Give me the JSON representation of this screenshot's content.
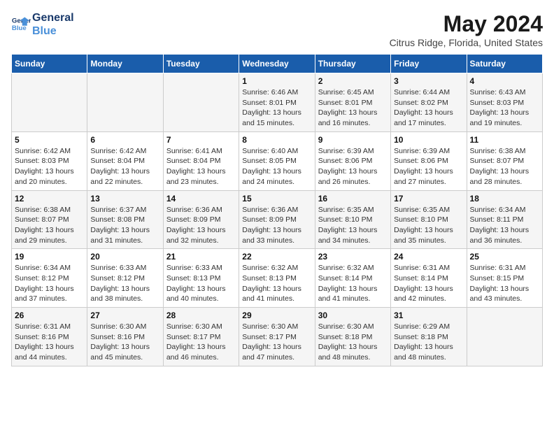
{
  "header": {
    "logo_line1": "General",
    "logo_line2": "Blue",
    "title": "May 2024",
    "subtitle": "Citrus Ridge, Florida, United States"
  },
  "weekdays": [
    "Sunday",
    "Monday",
    "Tuesday",
    "Wednesday",
    "Thursday",
    "Friday",
    "Saturday"
  ],
  "weeks": [
    [
      {
        "day": "",
        "info": ""
      },
      {
        "day": "",
        "info": ""
      },
      {
        "day": "",
        "info": ""
      },
      {
        "day": "1",
        "info": "Sunrise: 6:46 AM\nSunset: 8:01 PM\nDaylight: 13 hours\nand 15 minutes."
      },
      {
        "day": "2",
        "info": "Sunrise: 6:45 AM\nSunset: 8:01 PM\nDaylight: 13 hours\nand 16 minutes."
      },
      {
        "day": "3",
        "info": "Sunrise: 6:44 AM\nSunset: 8:02 PM\nDaylight: 13 hours\nand 17 minutes."
      },
      {
        "day": "4",
        "info": "Sunrise: 6:43 AM\nSunset: 8:03 PM\nDaylight: 13 hours\nand 19 minutes."
      }
    ],
    [
      {
        "day": "5",
        "info": "Sunrise: 6:42 AM\nSunset: 8:03 PM\nDaylight: 13 hours\nand 20 minutes."
      },
      {
        "day": "6",
        "info": "Sunrise: 6:42 AM\nSunset: 8:04 PM\nDaylight: 13 hours\nand 22 minutes."
      },
      {
        "day": "7",
        "info": "Sunrise: 6:41 AM\nSunset: 8:04 PM\nDaylight: 13 hours\nand 23 minutes."
      },
      {
        "day": "8",
        "info": "Sunrise: 6:40 AM\nSunset: 8:05 PM\nDaylight: 13 hours\nand 24 minutes."
      },
      {
        "day": "9",
        "info": "Sunrise: 6:39 AM\nSunset: 8:06 PM\nDaylight: 13 hours\nand 26 minutes."
      },
      {
        "day": "10",
        "info": "Sunrise: 6:39 AM\nSunset: 8:06 PM\nDaylight: 13 hours\nand 27 minutes."
      },
      {
        "day": "11",
        "info": "Sunrise: 6:38 AM\nSunset: 8:07 PM\nDaylight: 13 hours\nand 28 minutes."
      }
    ],
    [
      {
        "day": "12",
        "info": "Sunrise: 6:38 AM\nSunset: 8:07 PM\nDaylight: 13 hours\nand 29 minutes."
      },
      {
        "day": "13",
        "info": "Sunrise: 6:37 AM\nSunset: 8:08 PM\nDaylight: 13 hours\nand 31 minutes."
      },
      {
        "day": "14",
        "info": "Sunrise: 6:36 AM\nSunset: 8:09 PM\nDaylight: 13 hours\nand 32 minutes."
      },
      {
        "day": "15",
        "info": "Sunrise: 6:36 AM\nSunset: 8:09 PM\nDaylight: 13 hours\nand 33 minutes."
      },
      {
        "day": "16",
        "info": "Sunrise: 6:35 AM\nSunset: 8:10 PM\nDaylight: 13 hours\nand 34 minutes."
      },
      {
        "day": "17",
        "info": "Sunrise: 6:35 AM\nSunset: 8:10 PM\nDaylight: 13 hours\nand 35 minutes."
      },
      {
        "day": "18",
        "info": "Sunrise: 6:34 AM\nSunset: 8:11 PM\nDaylight: 13 hours\nand 36 minutes."
      }
    ],
    [
      {
        "day": "19",
        "info": "Sunrise: 6:34 AM\nSunset: 8:12 PM\nDaylight: 13 hours\nand 37 minutes."
      },
      {
        "day": "20",
        "info": "Sunrise: 6:33 AM\nSunset: 8:12 PM\nDaylight: 13 hours\nand 38 minutes."
      },
      {
        "day": "21",
        "info": "Sunrise: 6:33 AM\nSunset: 8:13 PM\nDaylight: 13 hours\nand 40 minutes."
      },
      {
        "day": "22",
        "info": "Sunrise: 6:32 AM\nSunset: 8:13 PM\nDaylight: 13 hours\nand 41 minutes."
      },
      {
        "day": "23",
        "info": "Sunrise: 6:32 AM\nSunset: 8:14 PM\nDaylight: 13 hours\nand 41 minutes."
      },
      {
        "day": "24",
        "info": "Sunrise: 6:31 AM\nSunset: 8:14 PM\nDaylight: 13 hours\nand 42 minutes."
      },
      {
        "day": "25",
        "info": "Sunrise: 6:31 AM\nSunset: 8:15 PM\nDaylight: 13 hours\nand 43 minutes."
      }
    ],
    [
      {
        "day": "26",
        "info": "Sunrise: 6:31 AM\nSunset: 8:16 PM\nDaylight: 13 hours\nand 44 minutes."
      },
      {
        "day": "27",
        "info": "Sunrise: 6:30 AM\nSunset: 8:16 PM\nDaylight: 13 hours\nand 45 minutes."
      },
      {
        "day": "28",
        "info": "Sunrise: 6:30 AM\nSunset: 8:17 PM\nDaylight: 13 hours\nand 46 minutes."
      },
      {
        "day": "29",
        "info": "Sunrise: 6:30 AM\nSunset: 8:17 PM\nDaylight: 13 hours\nand 47 minutes."
      },
      {
        "day": "30",
        "info": "Sunrise: 6:30 AM\nSunset: 8:18 PM\nDaylight: 13 hours\nand 48 minutes."
      },
      {
        "day": "31",
        "info": "Sunrise: 6:29 AM\nSunset: 8:18 PM\nDaylight: 13 hours\nand 48 minutes."
      },
      {
        "day": "",
        "info": ""
      }
    ]
  ]
}
